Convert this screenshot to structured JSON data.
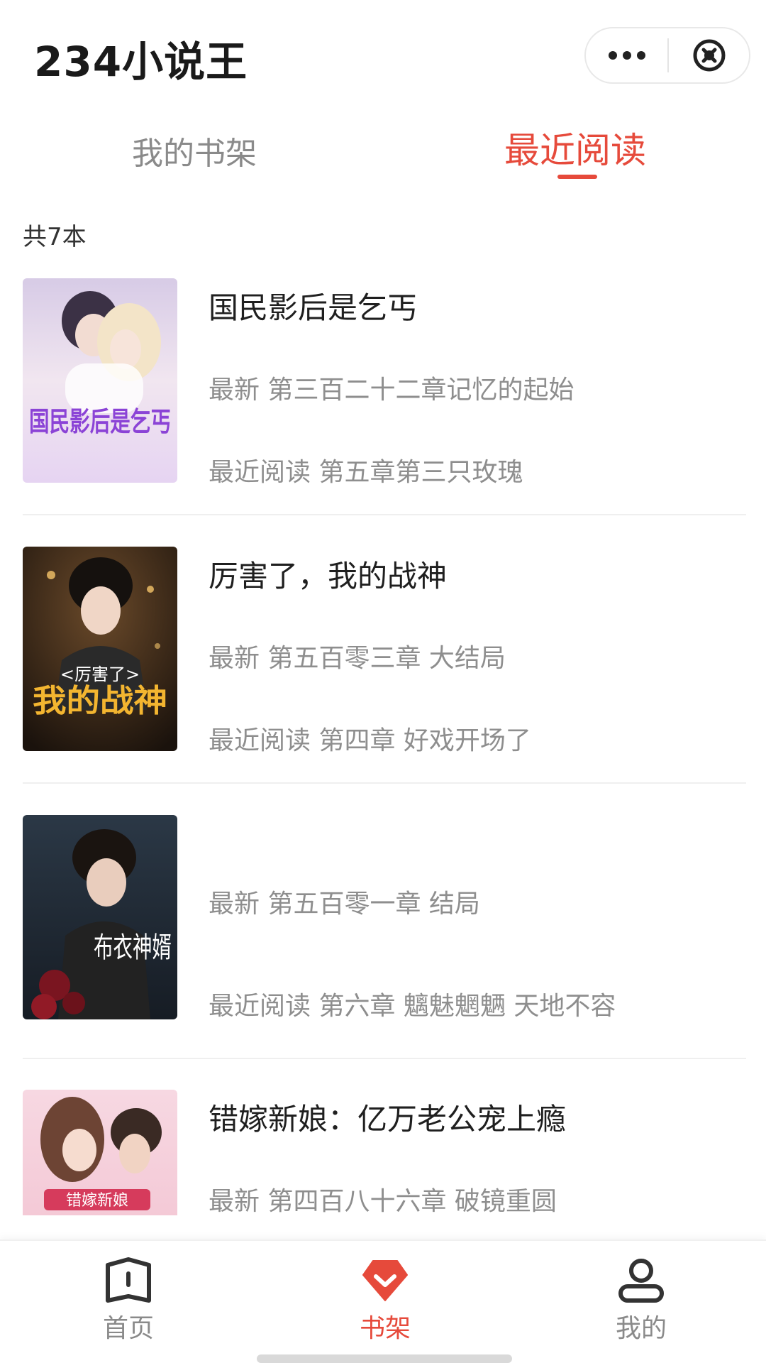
{
  "header": {
    "app_title": "234小说王"
  },
  "tabs": [
    {
      "label": "我的书架",
      "active": false
    },
    {
      "label": "最近阅读",
      "active": true
    }
  ],
  "colors": {
    "accent": "#e64a3b",
    "muted": "#8e8e8e"
  },
  "book_count": "共7本",
  "books": [
    {
      "title": "国民影后是乞丐",
      "latest": "最新 第三百二十二章记忆的起始",
      "recent": "最近阅读 第五章第三只玫瑰",
      "cover_text": "国民影后是乞丐"
    },
    {
      "title": "厉害了，我的战神",
      "latest": "最新 第五百零三章 大结局",
      "recent": "最近阅读 第四章 好戏开场了",
      "cover_text_top": "<厉害了>",
      "cover_text": "我的战神"
    },
    {
      "title": "",
      "latest": "最新 第五百零一章 结局",
      "recent": "最近阅读 第六章 魑魅魍魉 天地不容",
      "cover_text": "布衣神婿"
    },
    {
      "title": "错嫁新娘：亿万老公宠上瘾",
      "latest": "最新 第四百八十六章 破镜重圆",
      "recent": "",
      "cover_text": "错嫁新娘"
    }
  ],
  "bottom_nav": [
    {
      "label": "首页",
      "icon": "book-open-icon",
      "active": false
    },
    {
      "label": "书架",
      "icon": "bookshelf-icon",
      "active": true
    },
    {
      "label": "我的",
      "icon": "user-icon",
      "active": false
    }
  ]
}
